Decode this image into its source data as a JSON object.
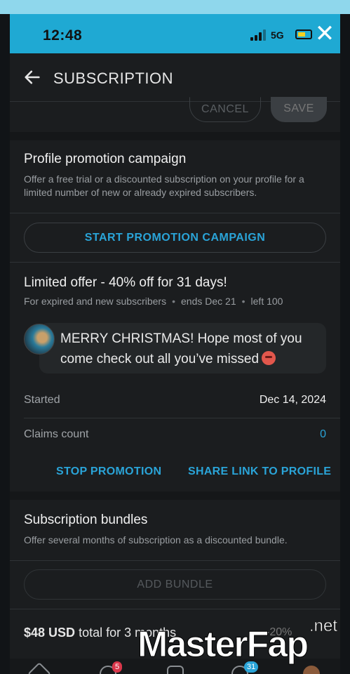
{
  "status_bar": {
    "time": "12:48",
    "network": "5G",
    "close_icon": "close-icon"
  },
  "header": {
    "title": "SUBSCRIPTION",
    "back_icon": "back-arrow-icon"
  },
  "actions": {
    "cancel": "CANCEL",
    "save": "SAVE"
  },
  "promotion": {
    "title": "Profile promotion campaign",
    "description": "Offer a free trial or a discounted subscription on your profile for a limited number of new or already expired subscribers.",
    "start_button": "START PROMOTION CAMPAIGN"
  },
  "offer": {
    "title": "Limited offer - 40% off for 31 days!",
    "audience": "For expired and new subscribers",
    "ends": "ends Dec 21",
    "left": "left 100",
    "message": "MERRY CHRISTMAS! Hope most of you come check out all you’ve missed",
    "started_label": "Started",
    "started_value": "Dec 14, 2024",
    "claims_label": "Claims count",
    "claims_value": "0",
    "stop_button": "STOP PROMOTION",
    "share_button": "SHARE LINK TO PROFILE"
  },
  "bundles": {
    "title": "Subscription bundles",
    "description": "Offer several months of subscription as a discounted bundle.",
    "add_button": "ADD BUNDLE",
    "price": "$48 USD",
    "total_text": "total for 3 months",
    "discount": "-20%"
  },
  "bottom_nav": {
    "messages_badge": "5",
    "notifications_badge": "31"
  },
  "watermark": {
    "brand": "MasterFap",
    "suffix": ".net"
  },
  "colors": {
    "accent": "#2aa4d8",
    "status_bar": "#1fa9d3",
    "background": "#1b1d1f"
  }
}
